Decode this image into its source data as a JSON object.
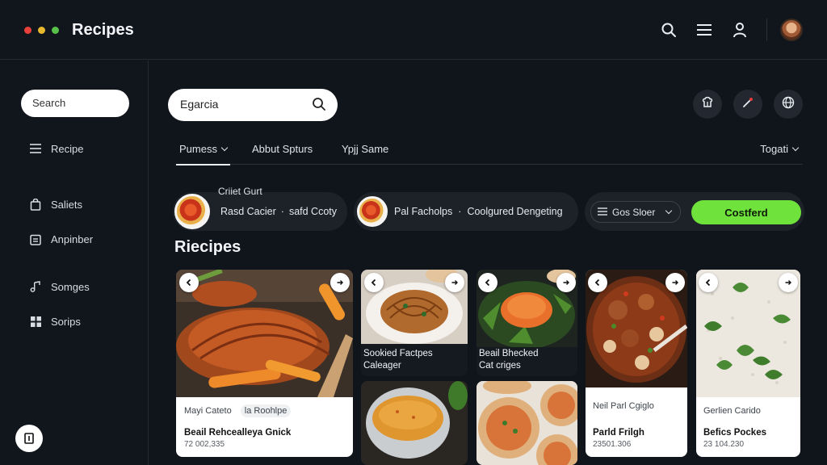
{
  "app": {
    "title": "Recipes",
    "traffic_colors": [
      "#e8403a",
      "#e8b82e",
      "#58c14a"
    ]
  },
  "topbar_icons": [
    "search-icon",
    "menu-icon",
    "user-icon",
    "avatar"
  ],
  "sidebar": {
    "search_placeholder": "Search",
    "items": [
      {
        "label": "Recipe",
        "icon": "list-icon"
      },
      {
        "label": "Saliets",
        "icon": "bag-icon"
      },
      {
        "label": "Anpinber",
        "icon": "calendar-icon"
      },
      {
        "label": "Somges",
        "icon": "music-icon"
      },
      {
        "label": "Sorips",
        "icon": "grid-icon"
      }
    ],
    "help_label": "?"
  },
  "main": {
    "search_value": "Egarcia",
    "action_icons": [
      "chef-icon",
      "pen-icon",
      "globe-icon"
    ],
    "tabs": [
      {
        "label": "Pumess",
        "has_chevron": true,
        "active": true
      },
      {
        "label": "Abbut Spturs",
        "has_chevron": false,
        "active": false
      },
      {
        "label": "Ypjj Same",
        "has_chevron": false,
        "active": false
      }
    ],
    "right_tab": {
      "label": "Togati",
      "has_chevron": true
    },
    "pills": [
      {
        "top": "Criiet Gurt",
        "left": "Rasd Cacier",
        "sep": "·",
        "right": "safd Ccoty"
      },
      {
        "left": "Pal Facholps",
        "sep": "·",
        "right": "Coolgured Dengeting"
      }
    ],
    "select_value": "Gos Sloer",
    "confirm_label": "Costferd",
    "section_title": "Riecipes"
  },
  "cards": [
    {
      "tag1": "Mayi Cateto",
      "tag2": "la Roohlpe",
      "name": "Beail Rehcealleya Gnick",
      "sub": "72 002,335"
    },
    {
      "label_line1": "Sookied Factpes",
      "label_line2": "Caleager"
    },
    {
      "label_line1": "Beail Bhecked",
      "label_line2": "Cat criges"
    },
    {
      "tag1": "Neil Parl Cgiglo",
      "name": "Parld Frilgh",
      "sub": "23501.306"
    },
    {
      "tag1": "Gerlien Carido",
      "name": "Befics Pockes",
      "sub": "23 104.230"
    }
  ],
  "colors": {
    "accent_green": "#6fe33c",
    "background": "#10141b"
  }
}
